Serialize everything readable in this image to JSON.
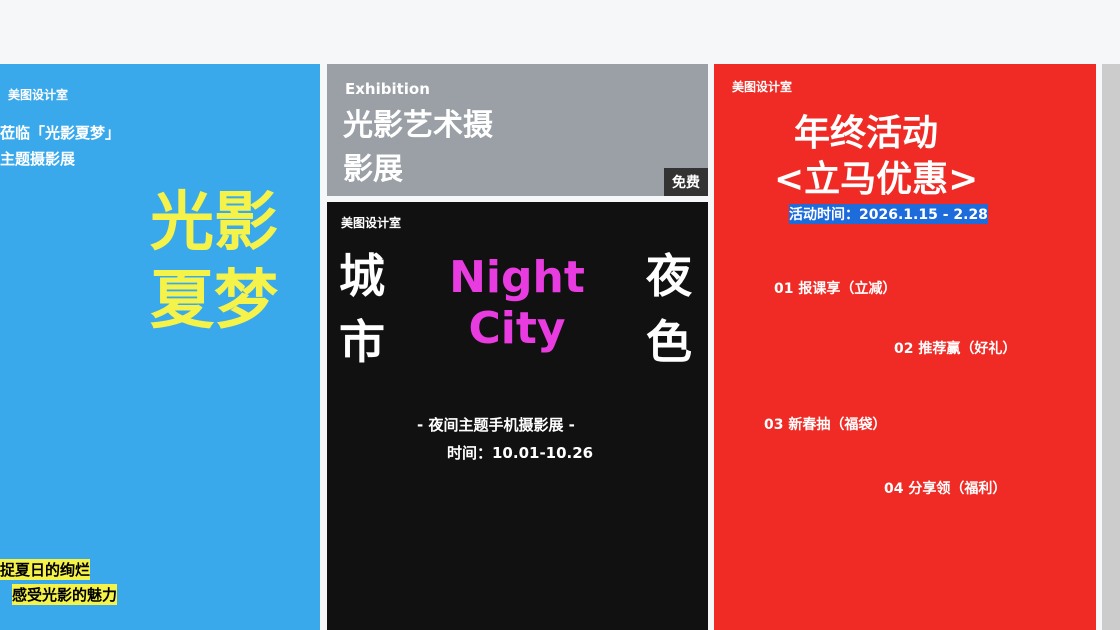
{
  "c1": {
    "brand": "美图设计室",
    "l1": "莅临「光影夏梦」",
    "l2": "主题摄影展",
    "title": "光影夏梦",
    "foot1": "捉夏日的绚烂",
    "foot2": "感受光影的魅力"
  },
  "c2": {
    "en": "Exhibition",
    "title": "光影艺术摄影展",
    "tag": "免费"
  },
  "c3": {
    "brand": "美图设计室",
    "left": "城市",
    "right": "夜色",
    "en": "Night City",
    "sub": "- 夜间主题手机摄影展 -",
    "time": "时间：10.01-10.26"
  },
  "c4": {
    "brand": "美图设计室",
    "title": "年终活动",
    "sub": "<立马优惠>",
    "date": "活动时间：2026.1.15 - 2.28",
    "s1": "01 报课享（立减）",
    "s2": "02 推荐赢（好礼）",
    "s3": "03 新春抽（福袋）",
    "s4": "04 分享领（福利）"
  }
}
